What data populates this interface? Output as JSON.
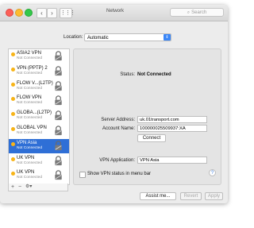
{
  "window": {
    "title": "Network",
    "search_placeholder": "Search",
    "nav": {
      "back": "‹",
      "forward": "›",
      "grid": "⋮⋮⋮"
    }
  },
  "location": {
    "label": "Location:",
    "value": "Automatic"
  },
  "sidebar": {
    "items": [
      {
        "name": "ASIA2 VPN",
        "status": "Not Connected"
      },
      {
        "name": "VPN (PPTP) 2",
        "status": "Not Connected"
      },
      {
        "name": "FLOW V...(L2TP)",
        "status": "Not Connected"
      },
      {
        "name": "FLOW VPN",
        "status": "Not Connected"
      },
      {
        "name": "GLOBA...(L2TP)",
        "status": "Not Connected"
      },
      {
        "name": "GLOBAL VPN",
        "status": "Not Connected"
      },
      {
        "name": "VPN Asia",
        "status": "Not Connected",
        "selected": true
      },
      {
        "name": "UK VPN",
        "status": "Not Connected"
      },
      {
        "name": "UK VPN",
        "status": "Not Connected"
      }
    ],
    "footer": {
      "add": "+",
      "remove": "−",
      "gear": "⚙▾"
    }
  },
  "detail": {
    "status_label": "Status:",
    "status_value": "Not Connected",
    "server_label": "Server Address:",
    "server_value": "uk.01transport.com",
    "account_label": "Account Name:",
    "account_value": "100000025509937:XA",
    "connect_label": "Connect",
    "vpn_app_label": "VPN Application:",
    "vpn_app_value": "VPN Asia",
    "show_status_label": "Show VPN status in menu bar",
    "help": "?"
  },
  "buttons": {
    "assist": "Assist me...",
    "revert": "Revert",
    "apply": "Apply"
  },
  "colors": {
    "selection": "#2f6fd6",
    "status_dot": "#f7b418"
  }
}
